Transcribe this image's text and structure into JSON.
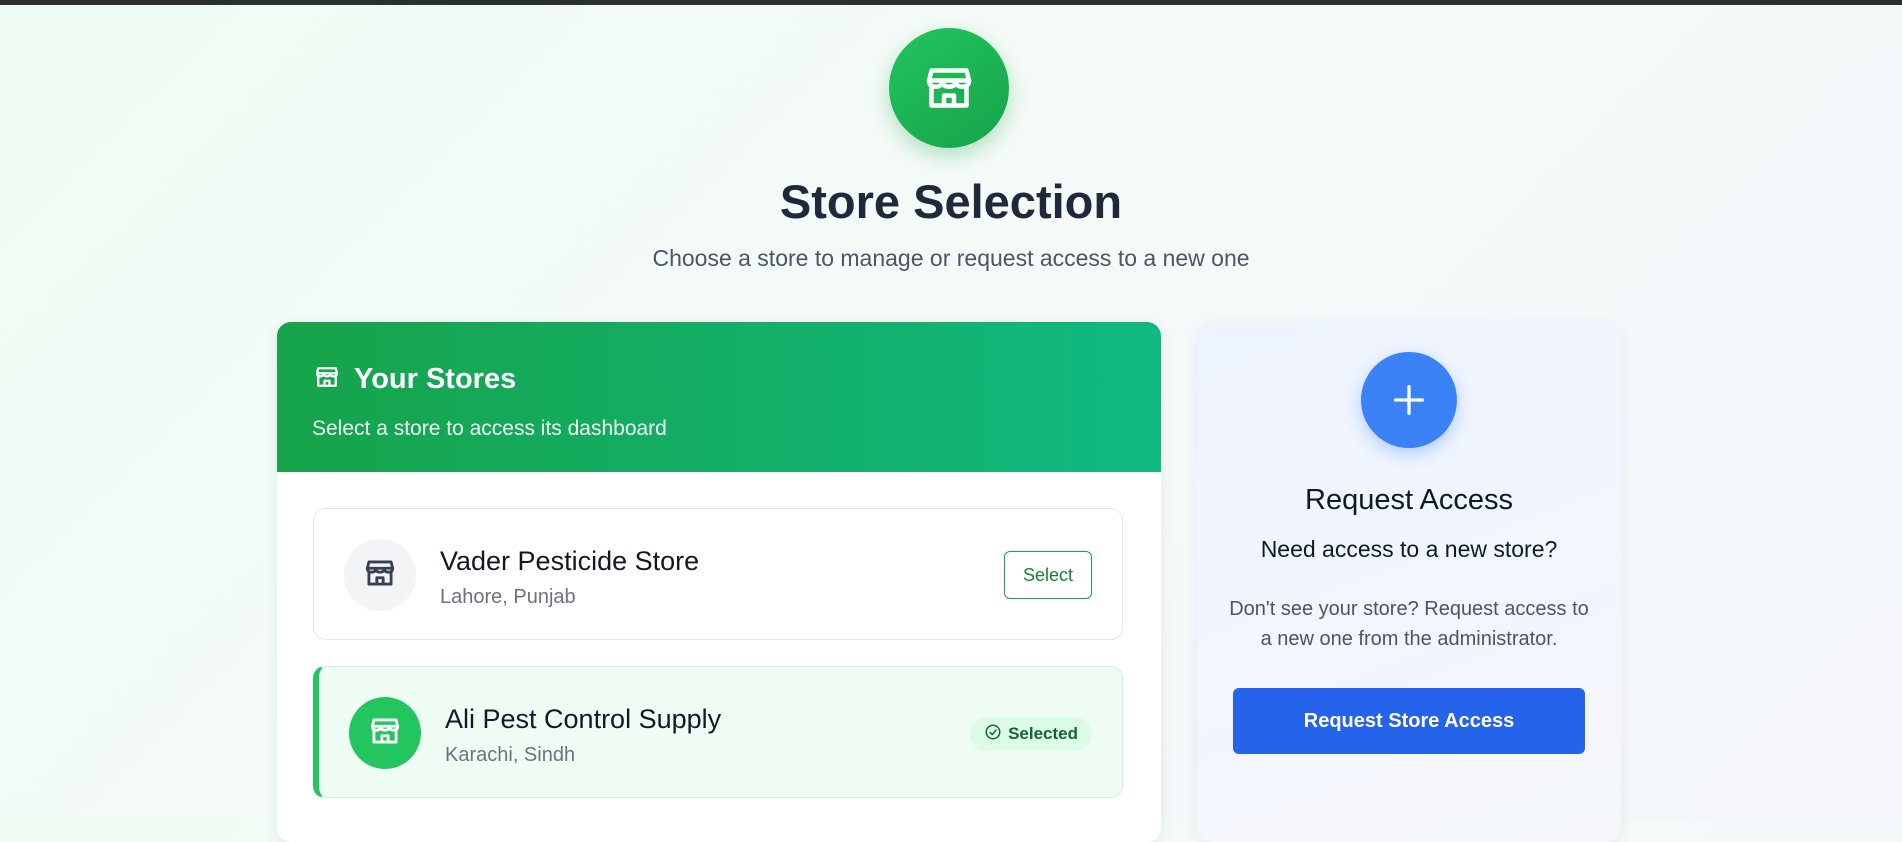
{
  "hero": {
    "icon": "store-icon",
    "title": "Store Selection",
    "subtitle": "Choose a store to manage or request access to a new one"
  },
  "stores_panel": {
    "icon": "store-icon",
    "title": "Your Stores",
    "subtitle": "Select a store to access its dashboard",
    "items": [
      {
        "name": "Vader Pesticide Store",
        "location": "Lahore, Punjab",
        "action_label": "Select",
        "state": "unselected"
      },
      {
        "name": "Ali Pest Control Supply",
        "location": "Karachi, Sindh",
        "badge_label": "Selected",
        "state": "selected"
      }
    ]
  },
  "access_panel": {
    "icon": "plus-icon",
    "title": "Request Access",
    "question": "Need access to a new store?",
    "description": "Don't see your store? Request access to a new one from the administrator.",
    "button_label": "Request Store Access"
  },
  "colors": {
    "brand_green": "#16a34a",
    "accent_blue": "#2563eb",
    "selected_bg": "#effcf3"
  }
}
